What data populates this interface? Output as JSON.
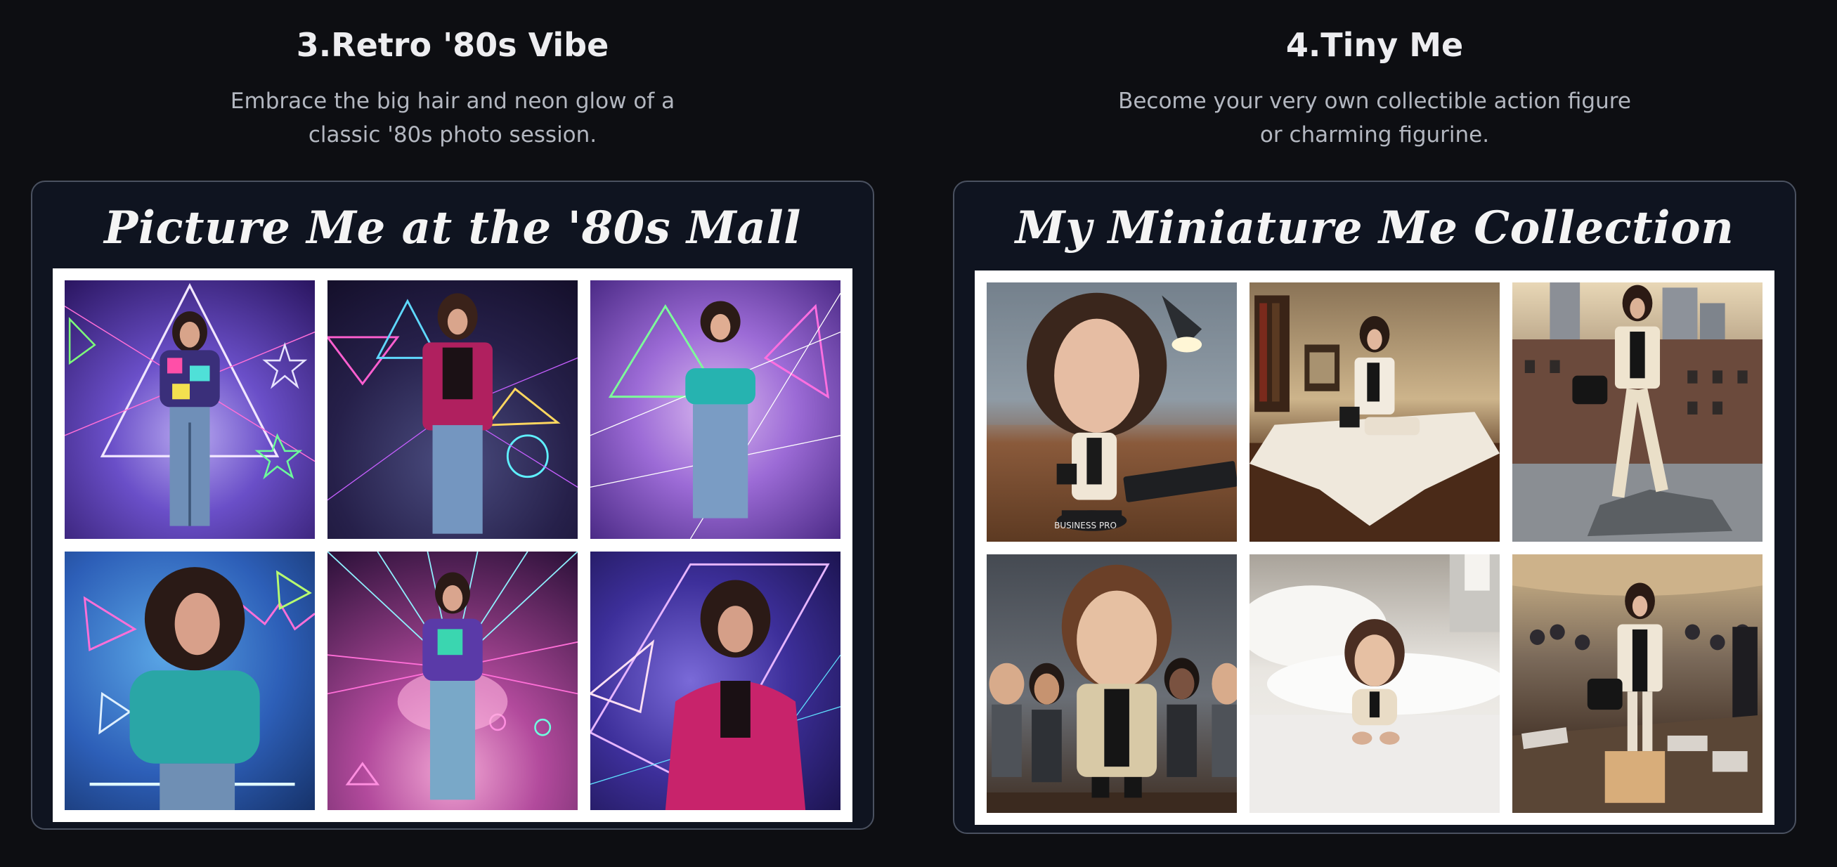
{
  "features": [
    {
      "title": "3.Retro '80s Vibe",
      "description": "Embrace the big hair and neon glow of a classic '80s photo session.",
      "card_title": "Picture Me at the '80s Mall",
      "photos": [
        "retro-photo-1",
        "retro-photo-2",
        "retro-photo-3",
        "retro-photo-4",
        "retro-photo-5",
        "retro-photo-6"
      ]
    },
    {
      "title": "4.Tiny Me",
      "description": "Become your very own collectible action figure or charming figurine.",
      "card_title": "My Miniature Me Collection",
      "photos": [
        "figurine-photo-1",
        "figurine-photo-2",
        "figurine-photo-3",
        "figurine-photo-4",
        "figurine-photo-5",
        "figurine-photo-6"
      ],
      "figurine_base_label": "BUSINESS PRO"
    }
  ],
  "colors": {
    "page_background": "#0d0e12",
    "card_background": "#0f1420",
    "card_border": "#4a5160",
    "title_text": "#ededf0",
    "description_text": "#b3b7c0"
  }
}
